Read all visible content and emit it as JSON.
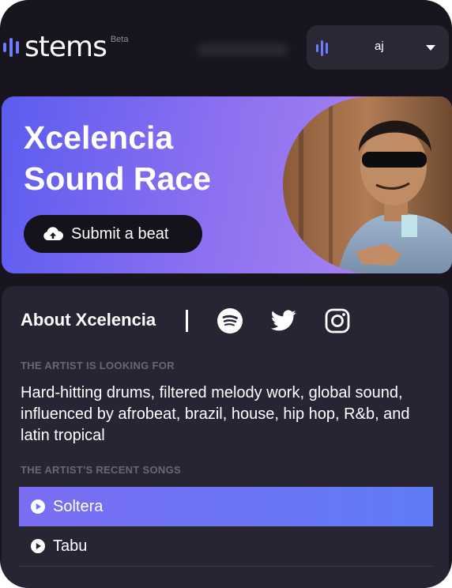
{
  "header": {
    "logo_text": "stems",
    "logo_badge": "Beta",
    "user_name": "aj",
    "accent_color": "#6a7dff"
  },
  "hero": {
    "title_line1": "Xcelencia",
    "title_line2": "Sound Race",
    "submit_label": "Submit a beat",
    "gradient_start": "#5b5cf0",
    "gradient_end": "#b48af2"
  },
  "about": {
    "title": "About Xcelencia",
    "social_icons": [
      "spotify-icon",
      "twitter-icon",
      "instagram-icon"
    ],
    "looking_label": "THE ARTIST IS LOOKING FOR",
    "looking_text": "Hard-hitting drums, filtered melody work, global sound, influenced by afrobeat, brazil, house, hip hop, R&b, and latin tropical",
    "songs_label": "THE ARTIST'S RECENT SONGS",
    "songs": [
      {
        "title": "Soltera",
        "active": true
      },
      {
        "title": "Tabu",
        "active": false
      }
    ]
  }
}
